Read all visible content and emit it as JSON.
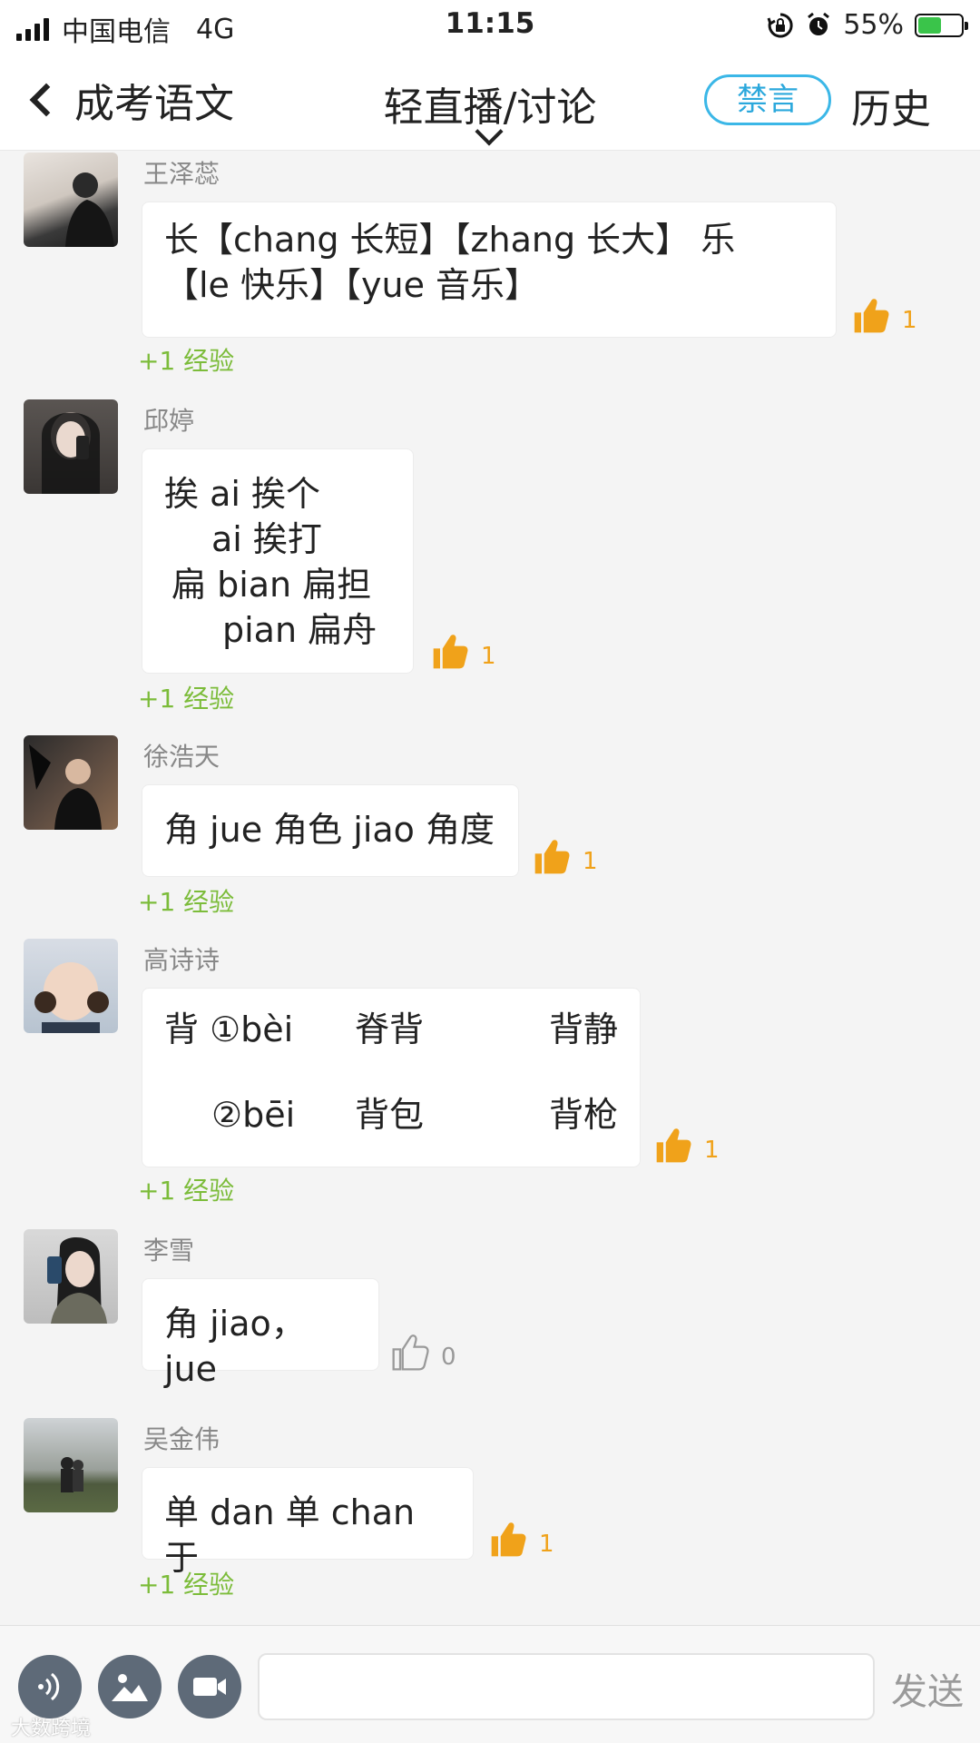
{
  "status_bar": {
    "carrier": "中国电信",
    "network": "4G",
    "time": "11:15",
    "battery": "55%",
    "battery_level": 0.55
  },
  "nav": {
    "back_label": "成考语文",
    "title": "轻直播/讨论",
    "mute_label": "禁言",
    "history_label": "历史"
  },
  "messages": [
    {
      "user": "王泽蕊",
      "lines": [
        "长【chang 长短】【zhang 长大】 乐",
        "【le 快乐】【yue 音乐】"
      ],
      "likes": "1",
      "exp": "+1 经验"
    },
    {
      "user": "邱婷",
      "lines": [
        "挨 ai 挨个",
        "ai 挨打",
        "扁 bian 扁担",
        "pian  扁舟"
      ],
      "likes": "1",
      "exp": "+1 经验"
    },
    {
      "user": "徐浩天",
      "lines": [
        "角 jue 角色 jiao 角度"
      ],
      "likes": "1",
      "exp": "+1 经验"
    },
    {
      "user": "高诗诗",
      "grid": [
        [
          "背 ①bèi",
          "脊背",
          "背静"
        ],
        [
          "②bēi",
          "背包",
          "背枪"
        ]
      ],
      "likes": "1",
      "exp": "+1 经验"
    },
    {
      "user": "李雪",
      "lines": [
        "角 jiao，jue"
      ],
      "likes": "0"
    },
    {
      "user": "吴金伟",
      "lines": [
        "单 dan 单 chan 于"
      ],
      "likes": "1",
      "exp": "+1 经验"
    }
  ],
  "input": {
    "placeholder": "",
    "send_label": "发送"
  },
  "watermark": "大数跨境",
  "colors": {
    "accent": "#3bb7e7",
    "like": "#f0a21a",
    "exp": "#7cbc3a"
  }
}
